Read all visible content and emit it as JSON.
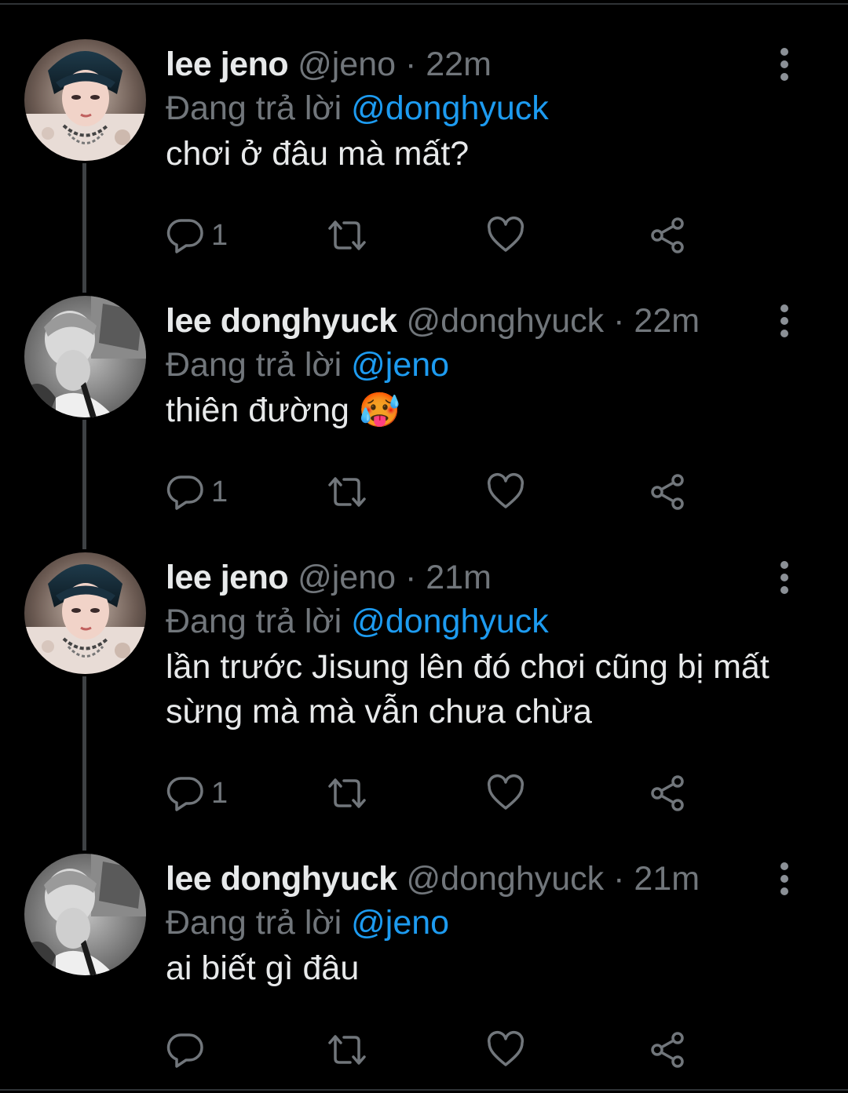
{
  "colors": {
    "background": "#000000",
    "text": "#e7e9ea",
    "secondary": "#71767b",
    "accent": "#1d9bf0",
    "thread_line": "#3e4144"
  },
  "tweets": [
    {
      "display_name": "lee jeno",
      "handle": "@jeno",
      "separator": "·",
      "time": "22m",
      "reply_prefix": "Đang trả lời",
      "reply_to": "@donghyuck",
      "text": "chơi ở đâu mà mất?",
      "reply_count": "1",
      "avatar": "jeno-avatar"
    },
    {
      "display_name": "lee donghyuck",
      "handle": "@donghyuck",
      "separator": "·",
      "time": "22m",
      "reply_prefix": "Đang trả lời",
      "reply_to": "@jeno",
      "text": "thiên đường 🥵",
      "reply_count": "1",
      "avatar": "donghyuck-avatar"
    },
    {
      "display_name": "lee jeno",
      "handle": "@jeno",
      "separator": "·",
      "time": "21m",
      "reply_prefix": "Đang trả lời",
      "reply_to": "@donghyuck",
      "text": "lần trước Jisung lên đó chơi cũng bị mất sừng mà mà vẫn chưa chừa",
      "reply_count": "1",
      "avatar": "jeno-avatar"
    },
    {
      "display_name": "lee donghyuck",
      "handle": "@donghyuck",
      "separator": "·",
      "time": "21m",
      "reply_prefix": "Đang trả lời",
      "reply_to": "@jeno",
      "text": "ai biết gì đâu",
      "reply_count": "",
      "avatar": "donghyuck-avatar"
    }
  ],
  "icons": [
    "reply-icon",
    "retweet-icon",
    "like-icon",
    "share-icon",
    "more-options-icon"
  ]
}
